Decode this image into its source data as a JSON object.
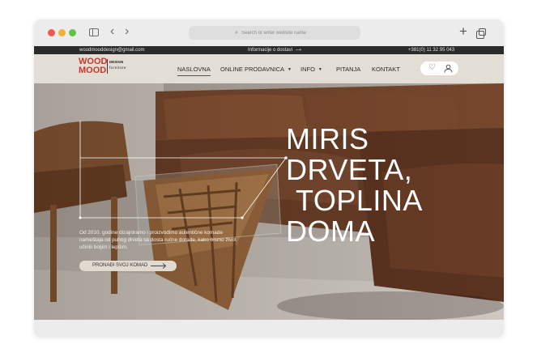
{
  "browser": {
    "address_placeholder": "Search or enter website name",
    "icons": [
      "sidebar-icon",
      "back-arrow-icon",
      "forward-arrow-icon",
      "search-icon",
      "new-tab-plus-icon",
      "tabs-overview-icon"
    ]
  },
  "topbar": {
    "email": "woodmooddesign@gmail.com",
    "delivery_info": "Informacije o dostavi",
    "phone": "+381(0) 11 32 95 043"
  },
  "logo": {
    "line1_part1": "WOOD",
    "line2_part1": "MOOD",
    "design": "DESIGN",
    "furniture": "furniture"
  },
  "nav": {
    "items": [
      {
        "label": "NASLOVNA",
        "active": true
      },
      {
        "label": "ONLINE PRODAVNICA",
        "dropdown": true
      },
      {
        "label": "INFO",
        "dropdown": true
      },
      {
        "label": "PITANJA"
      },
      {
        "label": "KONTAKT"
      }
    ]
  },
  "hero": {
    "headline": [
      "MIRIS",
      "DRVETA,",
      "TOPLINA",
      "DOMA"
    ],
    "intro": "Od 2010. godine dizajniramo i proizvodimo autentične komade nameštaja od punog drveta sa dosta ručne dorade, kako bismo život učinili boljim i lepšim.",
    "cta": "PRONAĐI SVOJ KOMAD"
  },
  "colors": {
    "accent_red": "#c6372a",
    "topbar_bg": "#2b2b2b",
    "header_bg": "#e3ded5",
    "leather": "#5b3521"
  }
}
